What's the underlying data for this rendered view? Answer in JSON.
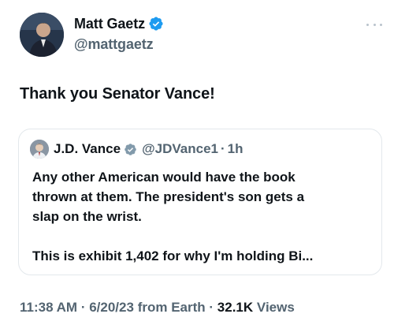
{
  "author": {
    "display_name": "Matt Gaetz",
    "handle": "@mattgaetz",
    "verified": true
  },
  "tweet": {
    "text": "Thank you Senator Vance!"
  },
  "quote": {
    "display_name": "J.D. Vance",
    "handle": "@JDVance1",
    "separator": "·",
    "time": "1h",
    "verified": true,
    "lines": [
      "Any other American would have the book",
      "thrown at them. The president's son gets a",
      "slap on the wrist."
    ],
    "second_paragraph": "This is exhibit 1,402 for why I'm holding Bi..."
  },
  "meta": {
    "time": "11:38 AM",
    "sep1": "·",
    "date": "6/20/23",
    "source": "from Earth",
    "sep2": "·",
    "views_count": "32.1K",
    "views_label": "Views"
  },
  "colors": {
    "verified_blue": "#1d9bf0",
    "text_primary": "#0f1419",
    "text_secondary": "#536471",
    "border": "#e3e8ec"
  },
  "icons": {
    "verified": "verified-badge-icon",
    "more": "more-options-icon"
  }
}
